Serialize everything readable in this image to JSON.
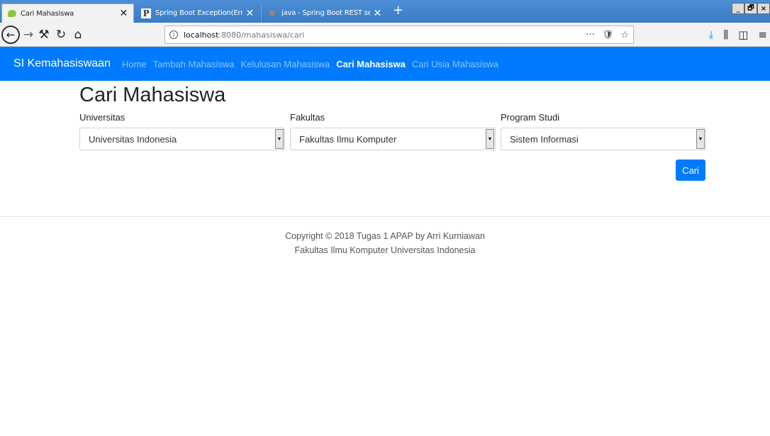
{
  "browser": {
    "tabs": [
      {
        "title": "Cari Mahasiswa",
        "active": true,
        "favicon": "spring-leaf-icon"
      },
      {
        "title": "Spring Boot Exception(Error) Hand",
        "active": false,
        "favicon": "p-letter-icon"
      },
      {
        "title": "java - Spring Boot REST service e",
        "active": false,
        "favicon": "stackoverflow-icon"
      }
    ],
    "close_glyph": "✕",
    "new_tab_glyph": "+",
    "window_controls": [
      "_",
      "🗗",
      "×"
    ],
    "url_host": "localhost",
    "url_path": ":8080/mahasiswa/cari",
    "url_actions": [
      "···",
      "🛡",
      "☆"
    ]
  },
  "app": {
    "brand": "SI Kemahasiswaan",
    "nav_links": [
      {
        "label": "Home",
        "active": false
      },
      {
        "label": "Tambah Mahasiswa",
        "active": false
      },
      {
        "label": "Kelulusan Mahasiswa",
        "active": false
      },
      {
        "label": "Cari Mahasiswa",
        "active": true
      },
      {
        "label": "Cari Usia Mahasiswa",
        "active": false
      }
    ],
    "accent_color": "#007bff"
  },
  "page": {
    "title": "Cari Mahasiswa",
    "fields": {
      "universitas": {
        "label": "Universitas",
        "value": "Universitas Indonesia"
      },
      "fakultas": {
        "label": "Fakultas",
        "value": "Fakultas Ilmu Komputer"
      },
      "prodi": {
        "label": "Program Studi",
        "value": "Sistem Informasi"
      }
    },
    "search_button": "Cari"
  },
  "footer": {
    "line1": "Copyright © 2018 Tugas 1 APAP by Arri Kurniawan",
    "line2": "Fakultas Ilmu Komputer Universitas Indonesia"
  }
}
